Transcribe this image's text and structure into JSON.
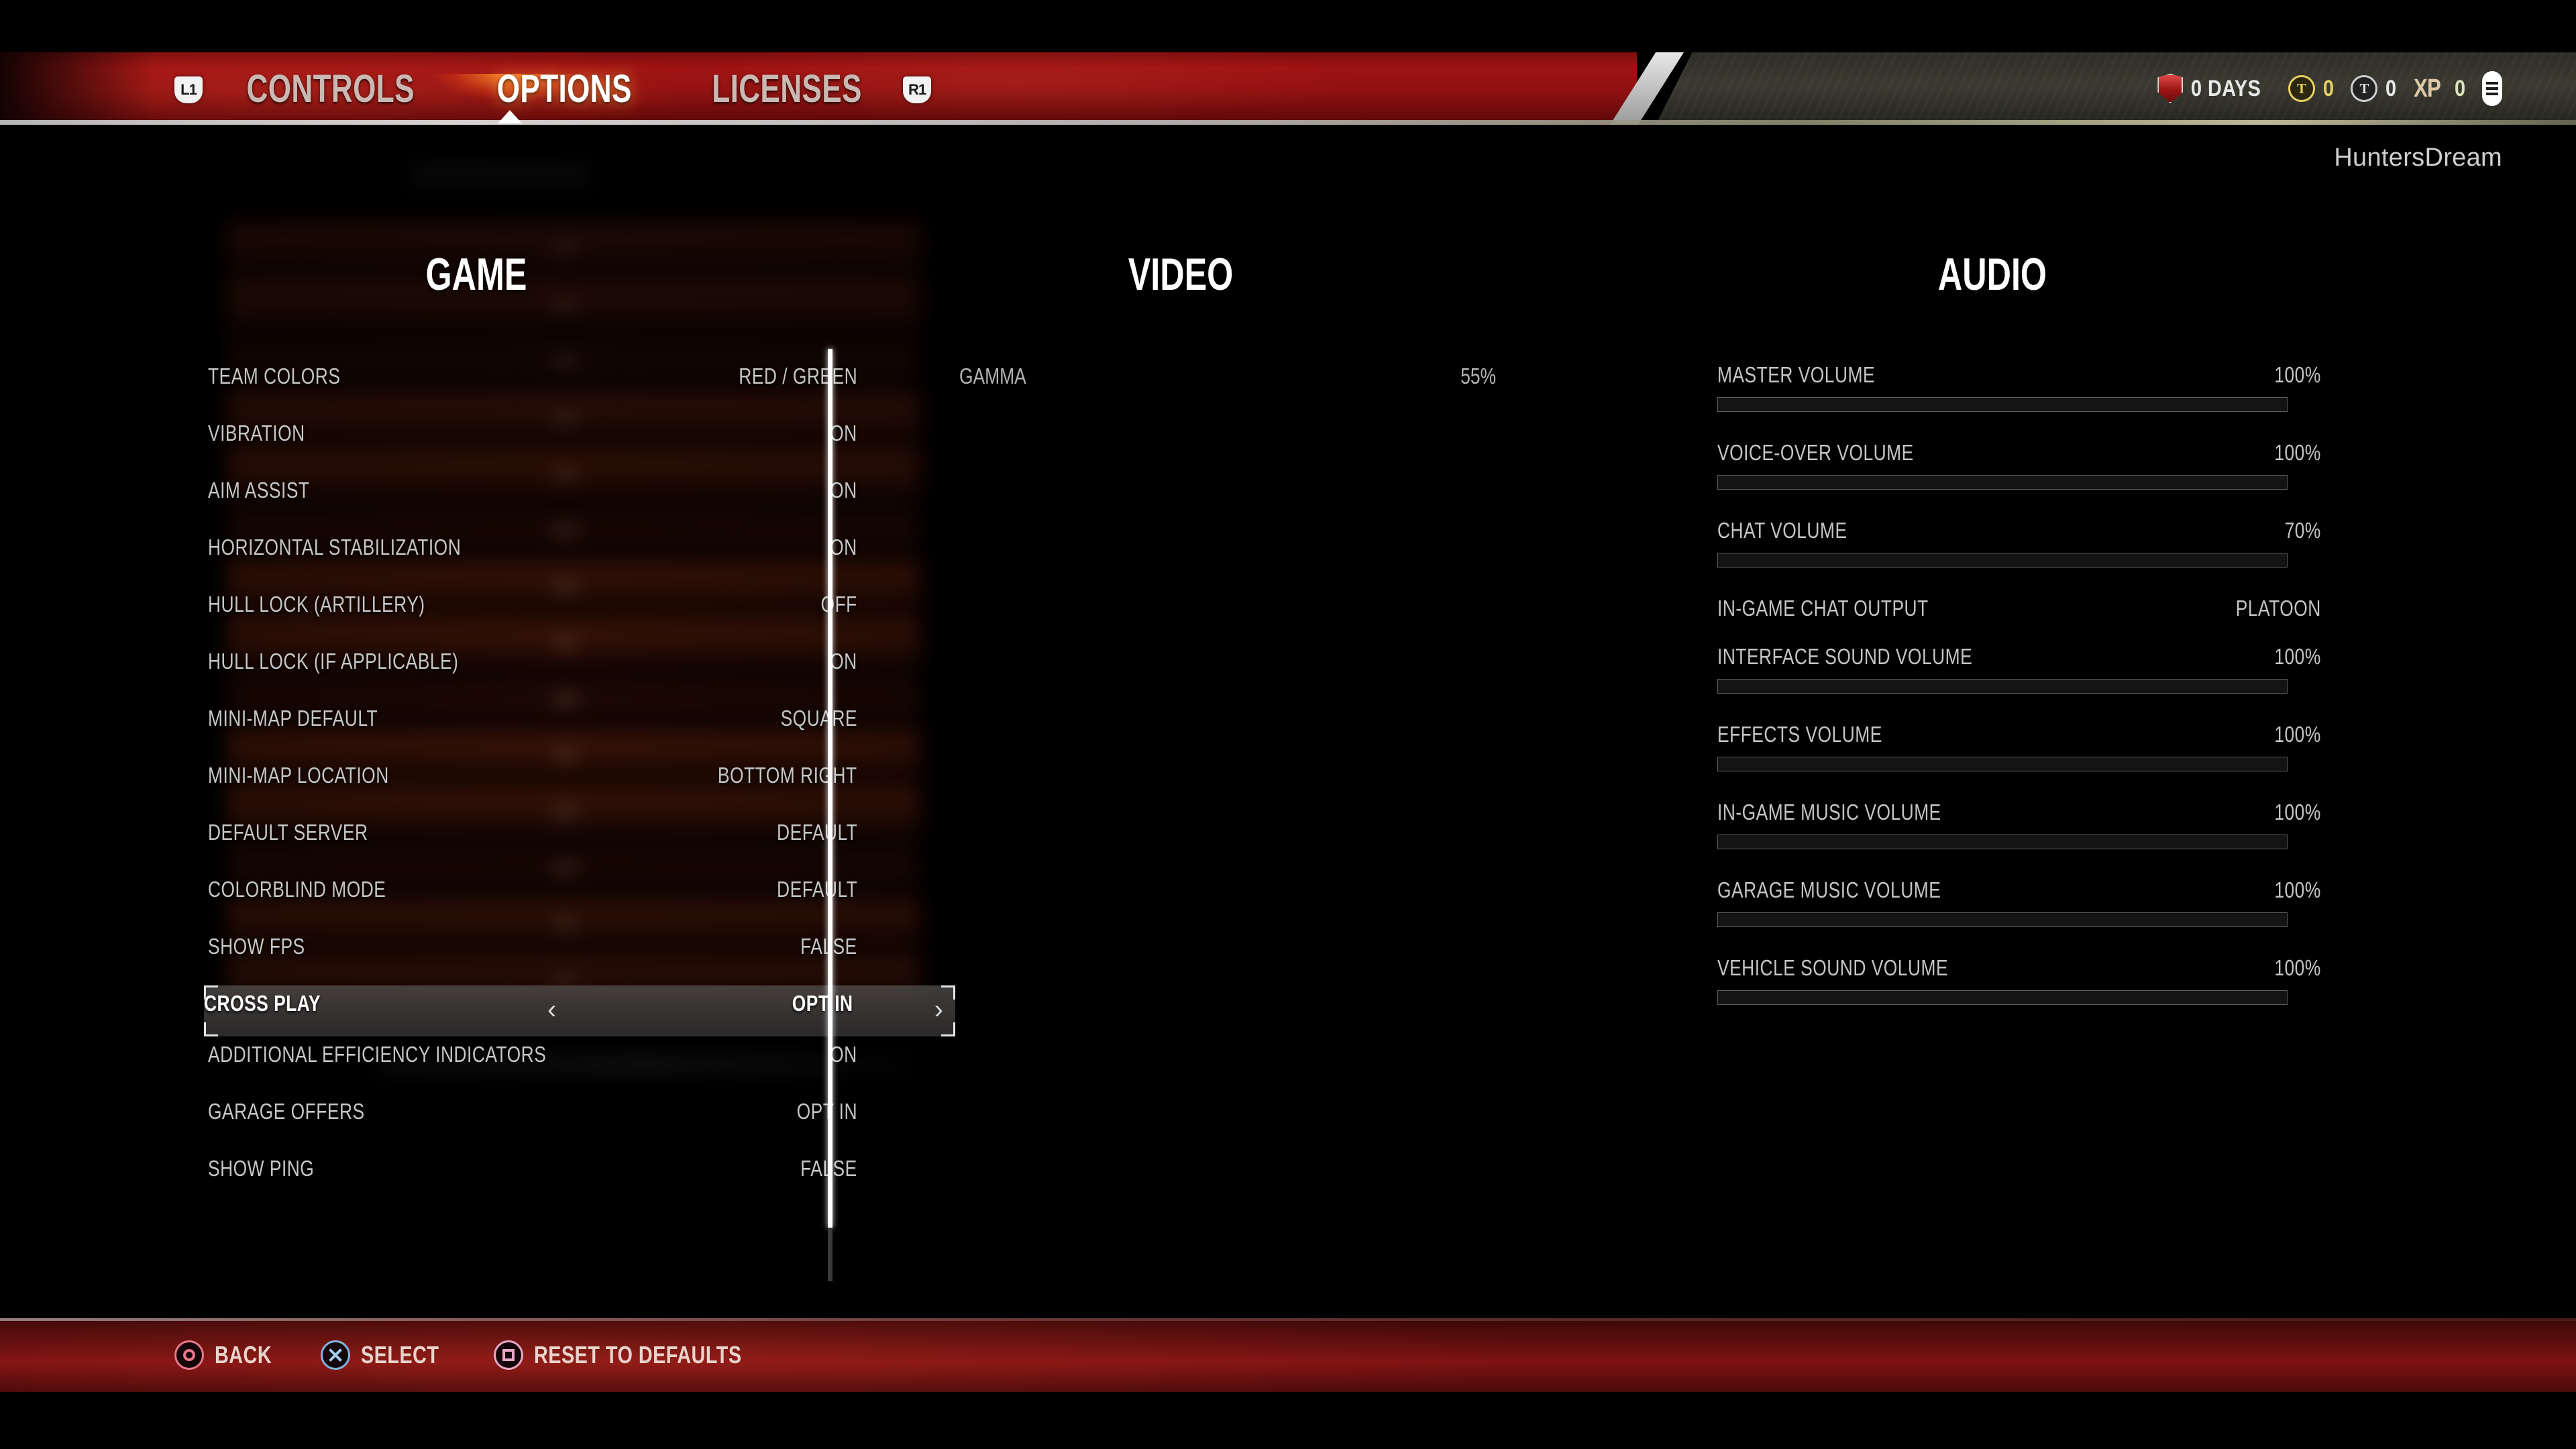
{
  "nav": {
    "left_bumper": "L1",
    "right_bumper": "R1",
    "items": [
      {
        "label": "CONTROLS",
        "active": false
      },
      {
        "label": "OPTIONS",
        "active": true
      },
      {
        "label": "LICENSES",
        "active": false
      }
    ]
  },
  "hud": {
    "premium_days": "0 DAYS",
    "gold": "0",
    "credits": "0",
    "xp_label": "XP",
    "xp": "0",
    "player_name": "HuntersDream"
  },
  "columns": {
    "game": {
      "title": "GAME",
      "rows": [
        {
          "label": "TEAM COLORS",
          "value": "RED / GREEN",
          "selected": false
        },
        {
          "label": "VIBRATION",
          "value": "ON",
          "selected": false
        },
        {
          "label": "AIM ASSIST",
          "value": "ON",
          "selected": false
        },
        {
          "label": "HORIZONTAL STABILIZATION",
          "value": "ON",
          "selected": false
        },
        {
          "label": "HULL LOCK (ARTILLERY)",
          "value": "OFF",
          "selected": false
        },
        {
          "label": "HULL LOCK (IF APPLICABLE)",
          "value": "ON",
          "selected": false
        },
        {
          "label": "MINI-MAP DEFAULT",
          "value": "SQUARE",
          "selected": false
        },
        {
          "label": "MINI-MAP LOCATION",
          "value": "BOTTOM RIGHT",
          "selected": false
        },
        {
          "label": "DEFAULT SERVER",
          "value": "DEFAULT",
          "selected": false
        },
        {
          "label": "COLORBLIND MODE",
          "value": "DEFAULT",
          "selected": false
        },
        {
          "label": "SHOW FPS",
          "value": "FALSE",
          "selected": false
        },
        {
          "label": "CROSS PLAY",
          "value": "OPT IN",
          "selected": true
        },
        {
          "label": "ADDITIONAL EFFICIENCY INDICATORS",
          "value": "ON",
          "selected": false
        },
        {
          "label": "GARAGE OFFERS",
          "value": "OPT IN",
          "selected": false
        },
        {
          "label": "SHOW PING",
          "value": "FALSE",
          "selected": false
        }
      ],
      "prev_chevron": "‹",
      "next_chevron": "›"
    },
    "video": {
      "title": "VIDEO",
      "rows": [
        {
          "label": "GAMMA",
          "value": "55%"
        }
      ]
    },
    "audio": {
      "title": "AUDIO",
      "rows": [
        {
          "label": "MASTER VOLUME",
          "value": "100%",
          "percent": 100,
          "has_slider": true
        },
        {
          "label": "VOICE-OVER VOLUME",
          "value": "100%",
          "percent": 100,
          "has_slider": true
        },
        {
          "label": "CHAT VOLUME",
          "value": "70%",
          "percent": 70,
          "has_slider": true
        },
        {
          "label": "IN-GAME CHAT OUTPUT",
          "value": "PLATOON",
          "percent": null,
          "has_slider": false
        },
        {
          "label": "INTERFACE SOUND VOLUME",
          "value": "100%",
          "percent": 100,
          "has_slider": true
        },
        {
          "label": "EFFECTS VOLUME",
          "value": "100%",
          "percent": 100,
          "has_slider": true
        },
        {
          "label": "IN-GAME MUSIC VOLUME",
          "value": "100%",
          "percent": 100,
          "has_slider": true
        },
        {
          "label": "GARAGE MUSIC VOLUME",
          "value": "100%",
          "percent": 100,
          "has_slider": true
        },
        {
          "label": "VEHICLE SOUND VOLUME",
          "value": "100%",
          "percent": 100,
          "has_slider": true
        }
      ]
    }
  },
  "footer": {
    "prompts": [
      {
        "button": "circle",
        "label": "BACK"
      },
      {
        "button": "cross",
        "label": "SELECT"
      },
      {
        "button": "square",
        "label": "RESET TO DEFAULTS"
      }
    ]
  },
  "colors": {
    "accent_red": "#9f1212",
    "accent_orange": "#ff8c28",
    "text_primary": "#c6c6c6",
    "text_bright": "#ffffff",
    "slider_fill": "#6e7073"
  }
}
